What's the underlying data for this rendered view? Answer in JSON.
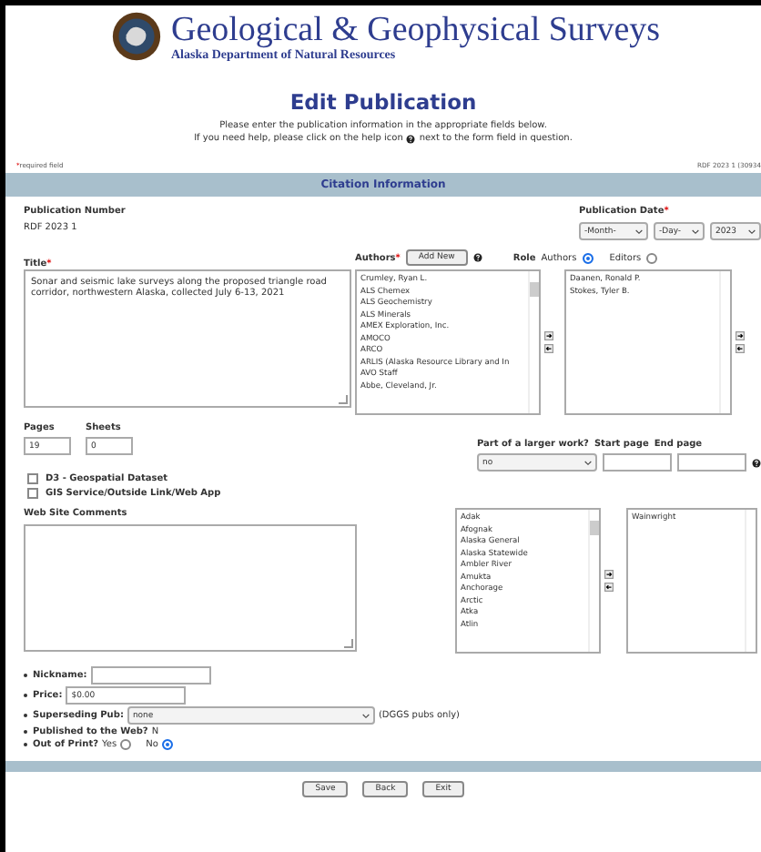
{
  "header": {
    "title": "Geological & Geophysical Surveys",
    "subtitle": "Alaska Department of Natural Resources"
  },
  "page_title": "Edit Publication",
  "instructions": {
    "line1": "Please enter the publication information in the appropriate fields below.",
    "before_icon": "If you need help, please click on the help icon",
    "after_icon": "next to the form field in question."
  },
  "required_note": {
    "mark": "*",
    "text": "required field"
  },
  "record_id": "RDF 2023 1 (30934",
  "section_title": "Citation Information",
  "publication_number": {
    "label": "Publication Number",
    "value": "RDF 2023 1"
  },
  "publication_date": {
    "label": "Publication Date",
    "mark": "*",
    "month": "-Month-",
    "day": "-Day-",
    "year": "2023"
  },
  "title_field": {
    "label": "Title",
    "mark": "*",
    "value": "Sonar and seismic lake surveys along the proposed triangle road corridor, northwestern Alaska, collected July 6-13, 2021"
  },
  "authors": {
    "label": "Authors",
    "mark": "*",
    "add_button": "Add New",
    "role_label": "Role",
    "roles": [
      {
        "label": "Authors",
        "selected": true
      },
      {
        "label": "Editors",
        "selected": false
      }
    ],
    "available": [
      "Crumley, Ryan L.",
      "ALS Chemex",
      "ALS Geochemistry",
      "ALS Minerals",
      "AMEX Exploration, Inc.",
      "AMOCO",
      "ARCO",
      "ARLIS (Alaska Resource Library and In",
      "AVO Staff",
      "Abbe, Cleveland, Jr."
    ],
    "chosen": [
      "Daanen, Ronald P.",
      "Stokes, Tyler B."
    ]
  },
  "pages": {
    "label": "Pages",
    "value": "19"
  },
  "sheets": {
    "label": "Sheets",
    "value": "0"
  },
  "checkboxes": [
    {
      "label": "D3 - Geospatial Dataset",
      "checked": false
    },
    {
      "label": "GIS Service/Outside Link/Web App",
      "checked": false
    }
  ],
  "larger_work": {
    "label": "Part of a larger work?",
    "value": "no",
    "start_label": "Start page",
    "end_label": "End page"
  },
  "web_comments": {
    "label": "Web Site Comments"
  },
  "quadrangles": {
    "available": [
      "Adak",
      "Afognak",
      "Alaska General",
      "Alaska Statewide",
      "Ambler River",
      "Amukta",
      "Anchorage",
      "Arctic",
      "Atka",
      "Atlin"
    ],
    "chosen": [
      "Wainwright"
    ]
  },
  "details": [
    {
      "kind": "field",
      "label": "Nickname:"
    },
    {
      "kind": "field",
      "label": "Price:",
      "value": "$0.00"
    },
    {
      "kind": "select",
      "label": "Superseding Pub:",
      "value": "none",
      "note": "(DGGS pubs only)"
    },
    {
      "kind": "static",
      "label": "Published to the Web?",
      "value": "N"
    },
    {
      "kind": "radio",
      "label": "Out of Print?",
      "options": [
        {
          "label": "Yes",
          "selected": false
        },
        {
          "label": "No",
          "selected": true
        }
      ]
    }
  ],
  "buttons": [
    "Save",
    "Back",
    "Exit"
  ]
}
